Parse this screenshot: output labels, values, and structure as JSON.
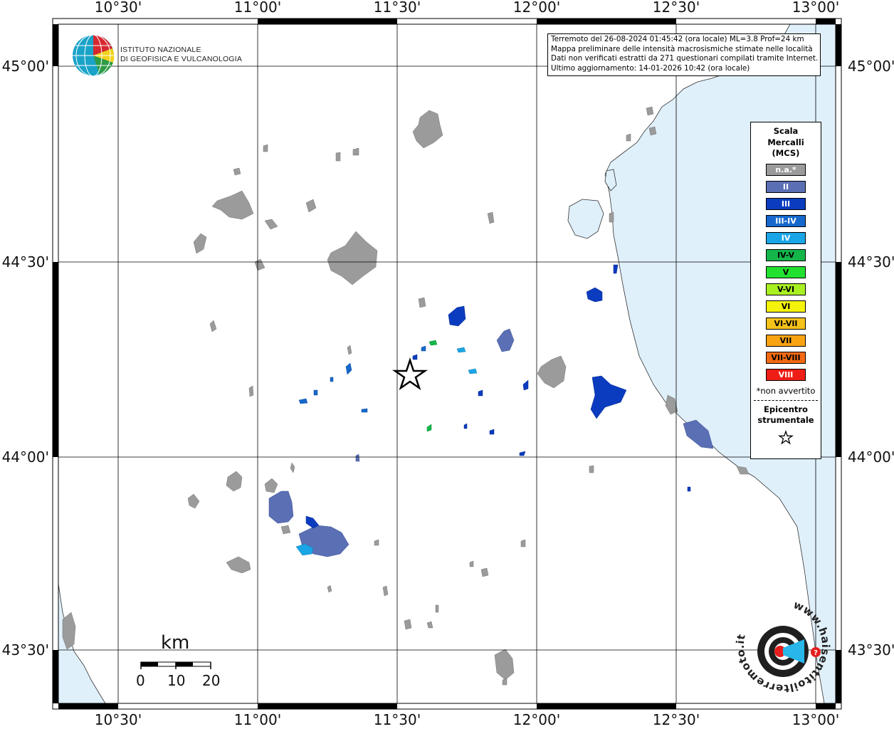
{
  "header": {
    "info_lines": [
      "Terremoto del 26-08-2024 01:45:42 (ora locale) ML=3.8 Prof=24 km",
      "Mappa preliminare delle intensità macrosismiche stimate nelle località",
      "Dati non verificati estratti da 271 questionari compilati tramite Internet.",
      "Ultimo aggiornamento: 14-01-2026 10:42 (ora locale)"
    ]
  },
  "institute": {
    "name_line1": "ISTITUTO NAZIONALE",
    "name_line2": "DI GEOFISICA E VULCANOLOGIA"
  },
  "axes": {
    "longitude_ticks": [
      "10°30'",
      "11°00'",
      "11°30'",
      "12°00'",
      "12°30'",
      "13°00'"
    ],
    "latitude_ticks": [
      "45°00'",
      "44°30'",
      "44°00'",
      "43°30'"
    ]
  },
  "legend": {
    "title_line1": "Scala",
    "title_line2": "Mercalli",
    "title_line3": "(MCS)",
    "items": [
      {
        "label": "n.a.*",
        "color": "#9b9b9b",
        "text_color": "#ffffff"
      },
      {
        "label": "II",
        "color": "#5a6fb4",
        "text_color": "#ffffff"
      },
      {
        "label": "III",
        "color": "#0b3bbf",
        "text_color": "#ffffff"
      },
      {
        "label": "III-IV",
        "color": "#1668cc",
        "text_color": "#ffffff"
      },
      {
        "label": "IV",
        "color": "#19a5e6",
        "text_color": "#ffffff"
      },
      {
        "label": "IV-V",
        "color": "#14b64a",
        "text_color": "#000000"
      },
      {
        "label": "V",
        "color": "#22e02f",
        "text_color": "#000000"
      },
      {
        "label": "V-VI",
        "color": "#a8f020",
        "text_color": "#000000"
      },
      {
        "label": "VI",
        "color": "#f5f20c",
        "text_color": "#000000"
      },
      {
        "label": "VI-VII",
        "color": "#f5c21a",
        "text_color": "#000000"
      },
      {
        "label": "VII",
        "color": "#f9a313",
        "text_color": "#000000"
      },
      {
        "label": "VII-VIII",
        "color": "#f46a12",
        "text_color": "#000000"
      },
      {
        "label": "VIII",
        "color": "#ee1d15",
        "text_color": "#ffffff"
      }
    ],
    "note": "*non avvertito",
    "epicenter_line1": "Epicentro",
    "epicenter_line2": "strumentale"
  },
  "scalebar": {
    "unit": "km",
    "labels": [
      "0",
      "10",
      "20"
    ]
  },
  "badge": {
    "text": "www.haisentitoilterremoto.it"
  },
  "colors": {
    "sea": "#dff0fb",
    "grid": "#000000",
    "na_gray": "#9b9b9b"
  }
}
